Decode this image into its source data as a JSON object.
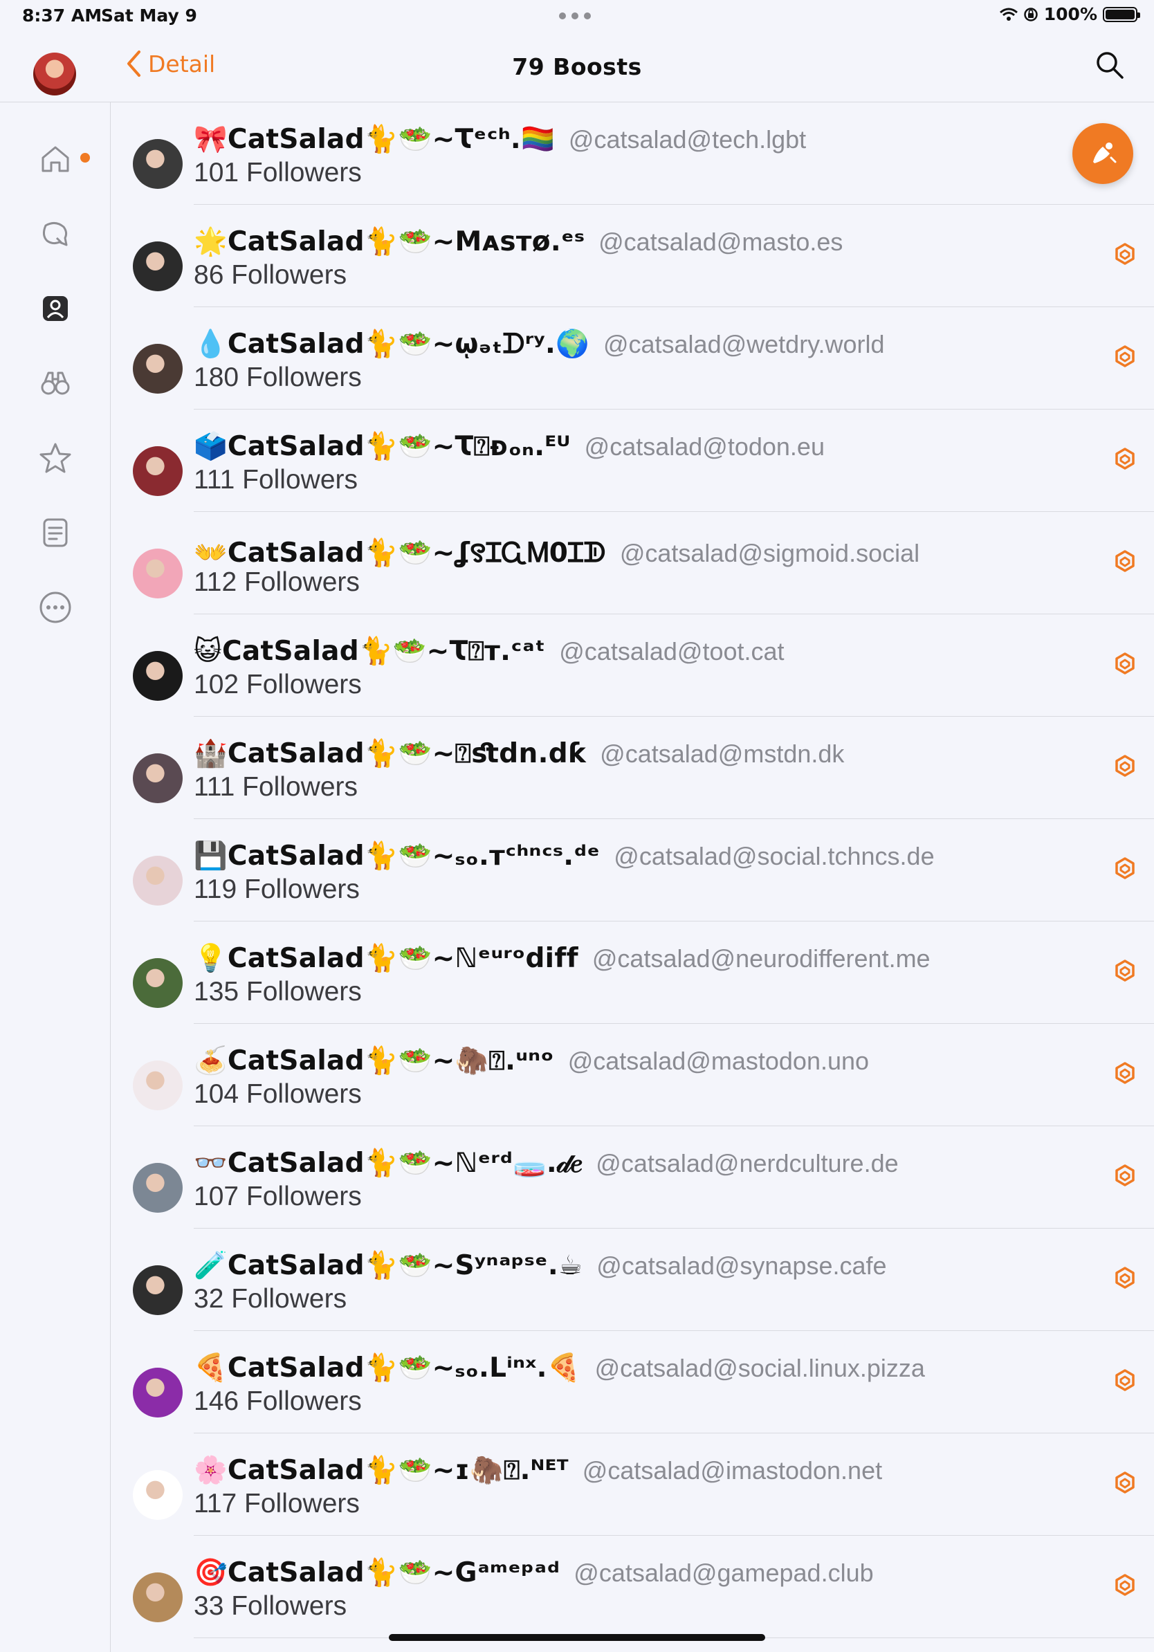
{
  "status_bar": {
    "time": "8:37 AM",
    "date": "Sat May 9",
    "battery": "100%"
  },
  "nav": {
    "back_label": "Detail",
    "title": "79 Boosts"
  },
  "accent_color": "#f07a23",
  "sidebar": {
    "items": [
      {
        "name": "home",
        "icon": "home-icon"
      },
      {
        "name": "notifications",
        "icon": "notifications-icon"
      },
      {
        "name": "profile",
        "icon": "profile-icon"
      },
      {
        "name": "explore",
        "icon": "binoculars-icon"
      },
      {
        "name": "favorites",
        "icon": "star-icon"
      },
      {
        "name": "lists",
        "icon": "list-icon"
      },
      {
        "name": "more",
        "icon": "more-icon"
      }
    ]
  },
  "users": [
    {
      "display_name": "🎀CatSalad🐈🥗∼Ꚍᵉᶜʰ.🏳️‍🌈",
      "handle": "@catsalad@tech.lgbt",
      "followers": "101 Followers"
    },
    {
      "display_name": "🌟CatSalad🐈🥗∼Mᴀꜱᴛø.ᵉˢ",
      "handle": "@catsalad@masto.es",
      "followers": "86 Followers"
    },
    {
      "display_name": "💧CatSalad🐈🥗∼ῳₔₜᗪʳʸ.🌍",
      "handle": "@catsalad@wetdry.world",
      "followers": "180 Followers"
    },
    {
      "display_name": "🗳️CatSalad🐈🥗∼Ꚍ⍰ᴆₒₙ.ᴱᵁ",
      "handle": "@catsalad@todon.eu",
      "followers": "111 Followers"
    },
    {
      "display_name": "👐CatSalad🐈🥗∼ʆ꯱ꞮᏩᎷ0Ɪᗫ",
      "handle": "@catsalad@sigmoid.social",
      "followers": "112 Followers"
    },
    {
      "display_name": "😺CatSalad🐈🥗∼Ꚍ⍰ᴛ.ᶜᵃᵗ",
      "handle": "@catsalad@toot.cat",
      "followers": "102 Followers"
    },
    {
      "display_name": "🏰CatSalad🐈🥗∼⍰ﬆdn.dƙ",
      "handle": "@catsalad@mstdn.dk",
      "followers": "111 Followers"
    },
    {
      "display_name": "💾CatSalad🐈🥗∼ₛₒ.ᴛᶜʰⁿᶜˢ.ᵈᵉ",
      "handle": "@catsalad@social.tchncs.de",
      "followers": "119 Followers"
    },
    {
      "display_name": "💡CatSalad🐈🥗∼ℕᵉᵘʳᵒdiff",
      "handle": "@catsalad@neurodifferent.me",
      "followers": "135 Followers"
    },
    {
      "display_name": "🍝CatSalad🐈🥗∼🦣⍰.ᵘⁿᵒ",
      "handle": "@catsalad@mastodon.uno",
      "followers": "104 Followers"
    },
    {
      "display_name": "👓CatSalad🐈🥗∼ℕᵉʳᵈ🧫.𝒹𝑒",
      "handle": "@catsalad@nerdculture.de",
      "followers": "107 Followers"
    },
    {
      "display_name": "🧪CatSalad🐈🥗∼Sʸⁿᵃᵖˢᵉ.☕",
      "handle": "@catsalad@synapse.cafe",
      "followers": "32 Followers"
    },
    {
      "display_name": "🍕CatSalad🐈🥗∼ₛₒ.Lⁱⁿˣ.🍕",
      "handle": "@catsalad@social.linux.pizza",
      "followers": "146 Followers"
    },
    {
      "display_name": "🌸CatSalad🐈🥗∼ɪ🦣⍰.ᴺᴱᵀ",
      "handle": "@catsalad@imastodon.net",
      "followers": "117 Followers"
    },
    {
      "display_name": "🎯CatSalad🐈🥗∼Gᵃᵐᵉᵖᵃᵈ",
      "handle": "@catsalad@gamepad.club",
      "followers": "33 Followers"
    }
  ],
  "avatar_colors": [
    "#3a3a3a",
    "#2b2b2b",
    "#4a3a34",
    "#8a2a30",
    "#f2a6b8",
    "#1a1a1a",
    "#5a4a52",
    "#e7d3d8",
    "#4b6b3a",
    "#f1e9ec",
    "#7c8794",
    "#2e2e2e",
    "#8b2ca8",
    "#ffffff",
    "#b48a5a"
  ]
}
